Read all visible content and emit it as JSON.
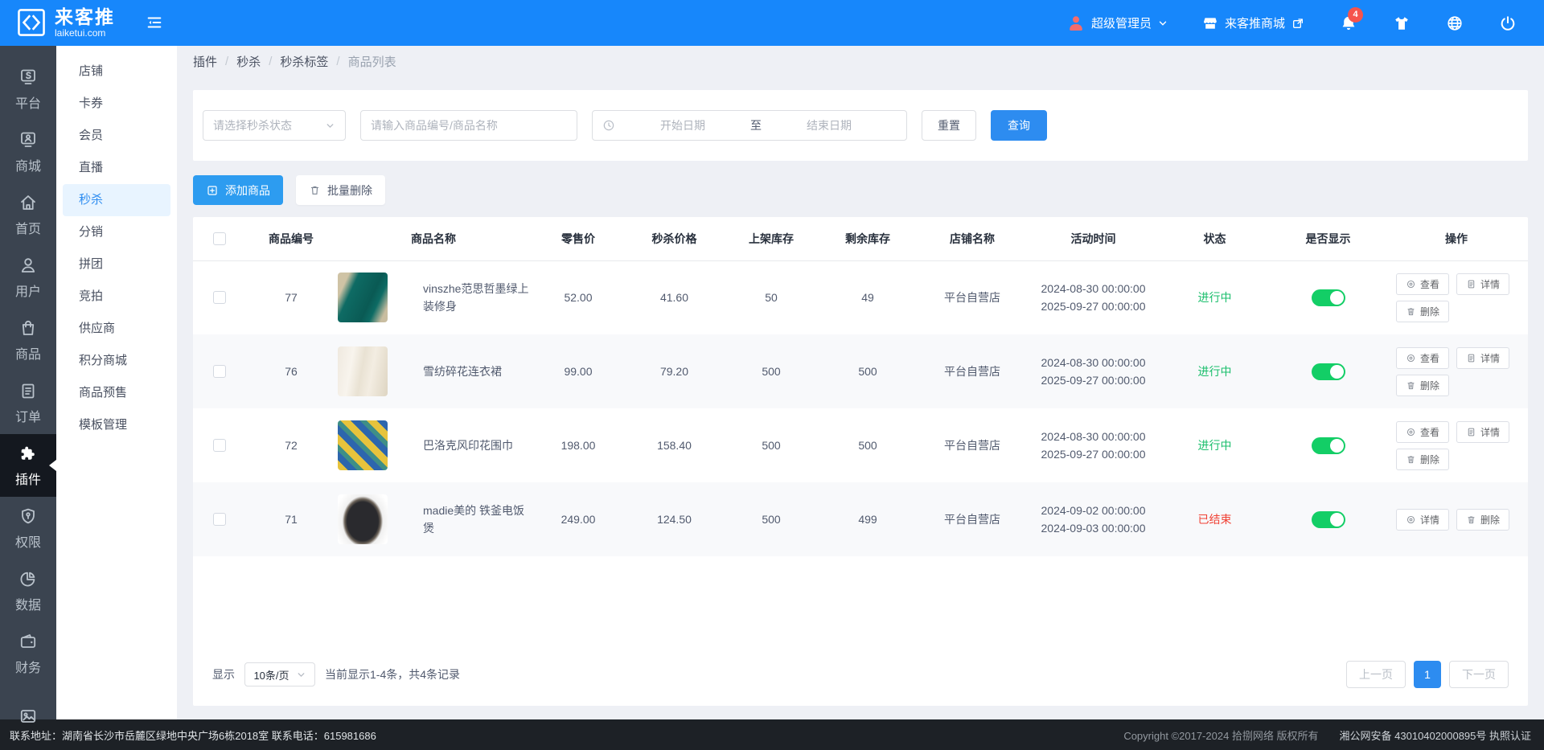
{
  "topbar": {
    "brand": {
      "name": "来客推",
      "domain": "laiketui.com"
    },
    "user_role": "超级管理员",
    "shop_link": "来客推商城",
    "notification_count": "4"
  },
  "primary_nav": {
    "items": [
      {
        "key": "platform",
        "label": "平台",
        "icon": "platform-icon"
      },
      {
        "key": "mall",
        "label": "商城",
        "icon": "mall-icon"
      },
      {
        "key": "home",
        "label": "首页",
        "icon": "home-icon"
      },
      {
        "key": "user",
        "label": "用户",
        "icon": "user-icon"
      },
      {
        "key": "goods",
        "label": "商品",
        "icon": "goods-icon"
      },
      {
        "key": "order",
        "label": "订单",
        "icon": "order-icon"
      },
      {
        "key": "plugin",
        "label": "插件",
        "icon": "plugin-icon",
        "active": true
      },
      {
        "key": "permission",
        "label": "权限",
        "icon": "permission-icon"
      },
      {
        "key": "data",
        "label": "数据",
        "icon": "data-icon"
      },
      {
        "key": "finance",
        "label": "财务",
        "icon": "finance-icon"
      },
      {
        "key": "media",
        "label": "",
        "icon": "media-icon"
      }
    ]
  },
  "secondary_nav": {
    "items": [
      {
        "key": "shop",
        "label": "店铺"
      },
      {
        "key": "coupon",
        "label": "卡券"
      },
      {
        "key": "member",
        "label": "会员"
      },
      {
        "key": "live",
        "label": "直播"
      },
      {
        "key": "seckill",
        "label": "秒杀",
        "active": true
      },
      {
        "key": "distribution",
        "label": "分销"
      },
      {
        "key": "groupbuy",
        "label": "拼团"
      },
      {
        "key": "auction",
        "label": "竞拍"
      },
      {
        "key": "supplier",
        "label": "供应商"
      },
      {
        "key": "points-mall",
        "label": "积分商城"
      },
      {
        "key": "presale",
        "label": "商品预售"
      },
      {
        "key": "template",
        "label": "模板管理"
      }
    ]
  },
  "breadcrumb": {
    "items": [
      "插件",
      "秒杀",
      "秒杀标签",
      "商品列表"
    ],
    "separator": "/"
  },
  "filters": {
    "status_placeholder": "请选择秒杀状态",
    "keyword_placeholder": "请输入商品编号/商品名称",
    "date_start_placeholder": "开始日期",
    "date_to_label": "至",
    "date_end_placeholder": "结束日期",
    "reset_label": "重置",
    "search_label": "查询"
  },
  "toolbar": {
    "add_label": "添加商品",
    "batch_delete_label": "批量删除"
  },
  "table": {
    "columns": [
      "商品编号",
      "商品名称",
      "零售价",
      "秒杀价格",
      "上架库存",
      "剩余库存",
      "店铺名称",
      "活动时间",
      "状态",
      "是否显示",
      "操作"
    ],
    "rows": [
      {
        "id": "77",
        "name": "vinszhe范思哲墨绿上装修身",
        "image": "teal-top",
        "image_desc": "墨绿色女士上装照片",
        "retail": "52.00",
        "price": "41.60",
        "stock": "50",
        "remain": "49",
        "shop": "平台自营店",
        "time_start": "2024-08-30 00:00:00",
        "time_end": "2025-09-27 00:00:00",
        "status": {
          "label": "进行中",
          "type": "ongoing"
        },
        "visible": true,
        "actions": [
          {
            "key": "view",
            "icon": "eye-icon",
            "label": "查看"
          },
          {
            "key": "detail",
            "icon": "doc-icon",
            "label": "详情"
          },
          {
            "key": "delete",
            "icon": "trash-icon",
            "label": "删除"
          }
        ]
      },
      {
        "id": "76",
        "name": "雪纺碎花连衣裙",
        "image": "cream-dress",
        "image_desc": "米白色连衣裙照片",
        "retail": "99.00",
        "price": "79.20",
        "stock": "500",
        "remain": "500",
        "shop": "平台自营店",
        "time_start": "2024-08-30 00:00:00",
        "time_end": "2025-09-27 00:00:00",
        "status": {
          "label": "进行中",
          "type": "ongoing"
        },
        "visible": true,
        "actions": [
          {
            "key": "view",
            "icon": "eye-icon",
            "label": "查看"
          },
          {
            "key": "detail",
            "icon": "doc-icon",
            "label": "详情"
          },
          {
            "key": "delete",
            "icon": "trash-icon",
            "label": "删除"
          }
        ]
      },
      {
        "id": "72",
        "name": "巴洛克风印花围巾",
        "image": "baroque-scarf",
        "image_desc": "蓝黄印花围巾照片",
        "retail": "198.00",
        "price": "158.40",
        "stock": "500",
        "remain": "500",
        "shop": "平台自营店",
        "time_start": "2024-08-30 00:00:00",
        "time_end": "2025-09-27 00:00:00",
        "status": {
          "label": "进行中",
          "type": "ongoing"
        },
        "visible": true,
        "actions": [
          {
            "key": "view",
            "icon": "eye-icon",
            "label": "查看"
          },
          {
            "key": "detail",
            "icon": "doc-icon",
            "label": "详情"
          },
          {
            "key": "delete",
            "icon": "trash-icon",
            "label": "删除"
          }
        ]
      },
      {
        "id": "71",
        "name": "madie美的 铁釜电饭煲",
        "image": "rice-cooker",
        "image_desc": "黑色电饭煲照片",
        "retail": "249.00",
        "price": "124.50",
        "stock": "500",
        "remain": "499",
        "shop": "平台自营店",
        "time_start": "2024-09-02 00:00:00",
        "time_end": "2024-09-03 00:00:00",
        "status": {
          "label": "已结束",
          "type": "ended"
        },
        "visible": true,
        "actions": [
          {
            "key": "detail",
            "icon": "eye-icon",
            "label": "详情"
          },
          {
            "key": "delete",
            "icon": "trash-icon",
            "label": "删除"
          }
        ]
      }
    ]
  },
  "pagination": {
    "show_label": "显示",
    "per_page": "10条/页",
    "summary": "当前显示1-4条，共4条记录",
    "prev_label": "上一页",
    "current_page": "1",
    "next_label": "下一页"
  },
  "footer": {
    "contact": "联系地址：湖南省长沙市岳麓区绿地中央广场6栋2018室 联系电话：615981686",
    "copyright": "Copyright ©2017-2024 拾捌网络 版权所有",
    "police_record": "湘公网安备 43010402000895号 执照认证"
  },
  "colors": {
    "topbar_blue": "#1787fb",
    "accent_blue": "#2d8cf0",
    "toggle_green": "#13ce66",
    "status_ongoing_green": "#19be6b",
    "status_ended_red": "#f04134",
    "badge_red": "#f5544d",
    "avatar_coral": "#f56c6c",
    "active_nav_bg": "#14181f",
    "sidebar_bg": "#3b4450"
  }
}
